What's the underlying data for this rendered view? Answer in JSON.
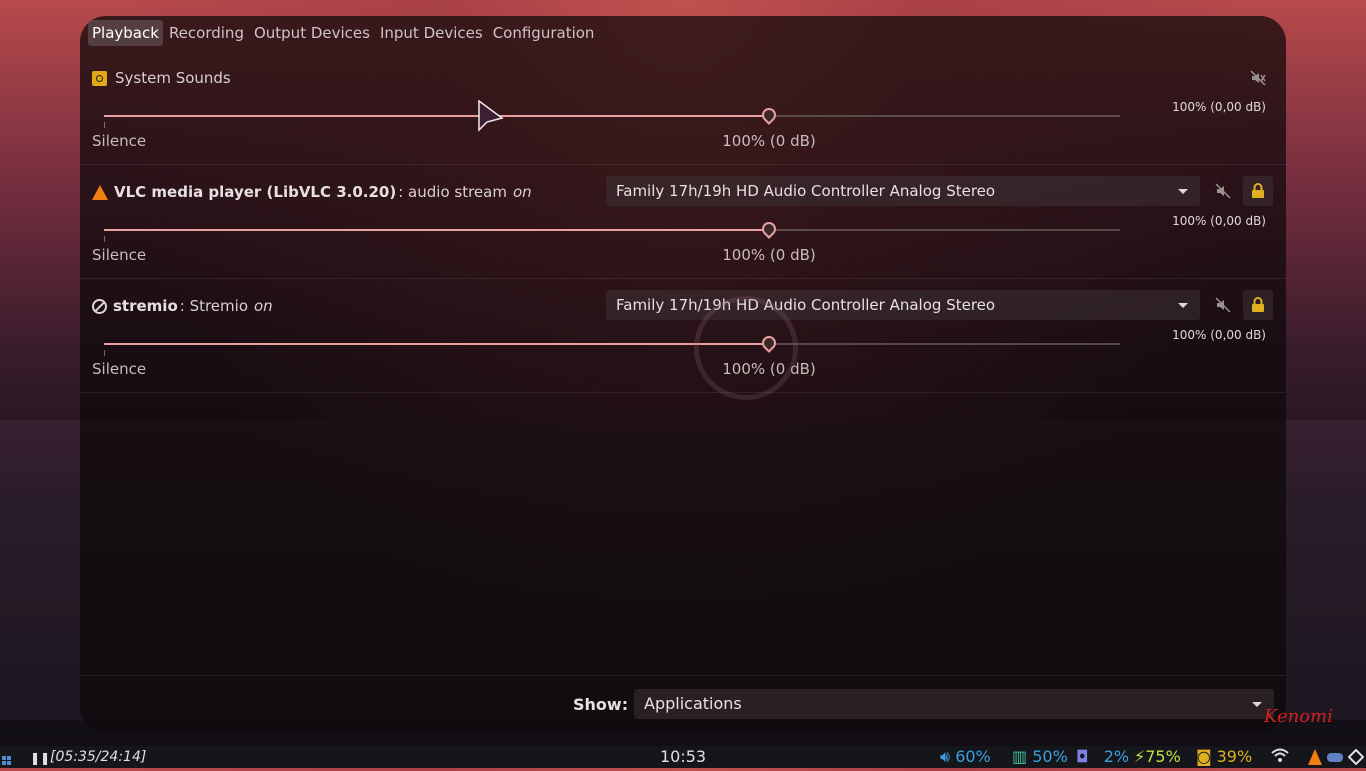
{
  "tabs": [
    {
      "label": "Playback",
      "active": true
    },
    {
      "label": "Recording",
      "active": false
    },
    {
      "label": "Output Devices",
      "active": false
    },
    {
      "label": "Input Devices",
      "active": false
    },
    {
      "label": "Configuration",
      "active": false
    }
  ],
  "streams": [
    {
      "icon": "speaker-icon",
      "name": "System Sounds",
      "volume_readout": "100% (0,00 dB)",
      "volume_fraction": 0.655,
      "silence_label": "Silence",
      "hundred_label": "100% (0 dB)"
    },
    {
      "icon": "vlc-icon",
      "app_name": "VLC media player (LibVLC 3.0.20)",
      "stream_desc": ": audio stream",
      "on_label": "on",
      "device": "Family 17h/19h HD Audio Controller Analog Stereo",
      "volume_readout": "100% (0,00 dB)",
      "volume_fraction": 0.655,
      "silence_label": "Silence",
      "hundred_label": "100% (0 dB)"
    },
    {
      "icon": "blocked-icon",
      "app_name": "stremio",
      "stream_desc": ": Stremio",
      "on_label": "on",
      "device": "Family 17h/19h HD Audio Controller Analog Stereo",
      "volume_readout": "100% (0,00 dB)",
      "volume_fraction": 0.655,
      "silence_label": "Silence",
      "hundred_label": "100% (0 dB)"
    }
  ],
  "footer": {
    "show_label": "Show:",
    "show_value": "Applications"
  },
  "taskbar": {
    "media_time": "[05:35/24:14]",
    "clock": "10:53",
    "volume": "60%",
    "memory": "50%",
    "cpu": "2%",
    "battery": "75%",
    "brightness": "39%"
  },
  "signature": "Kenomi",
  "colors": {
    "accent": "#e8a0a0",
    "volume": "#3aa0e0",
    "memory": "#3aa0e0",
    "cpu": "#3aa0e0",
    "battery": "#c0e040",
    "brightness": "#e0b020"
  }
}
